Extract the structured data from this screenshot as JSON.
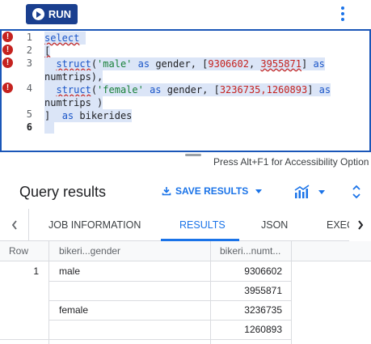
{
  "toolbar": {
    "run_label": "RUN"
  },
  "editor": {
    "lines": [
      {
        "n": "1",
        "error": true
      },
      {
        "n": "2",
        "error": true
      },
      {
        "n": "3",
        "error": true
      },
      {
        "n": "4",
        "error": true
      },
      {
        "n": "5",
        "error": false
      },
      {
        "n": "6",
        "error": false
      }
    ],
    "error_glyph": "!",
    "code": {
      "l1": "select",
      "l2": "[",
      "l3a_struct": "struct",
      "l3a_str": "'male'",
      "l3a_as": "as",
      "l3a_gender": "gender",
      "l3a_n1": "9306602",
      "l3a_n2": "3955871",
      "l3a_as2": "as",
      "l3b": "numtrips),",
      "l4a_struct": "struct",
      "l4a_str": "'female'",
      "l4a_as": "as",
      "l4a_gender": "gender",
      "l4a_nums": "3236735,1260893",
      "l4a_as2": "as",
      "l4b": "numtrips )",
      "l5": "]",
      "l5_as": "as",
      "l5_alias": "bikerides"
    },
    "accessibility_hint": "Press Alt+F1 for Accessibility Option"
  },
  "results": {
    "title": "Query results",
    "save_label": "SAVE RESULTS",
    "tabs": [
      {
        "label": "JOB INFORMATION",
        "active": false
      },
      {
        "label": "RESULTS",
        "active": true
      },
      {
        "label": "JSON",
        "active": false
      },
      {
        "label": "EXEC",
        "active": false
      }
    ],
    "table": {
      "columns": [
        "Row",
        "bikeri...gender",
        "bikeri...numt..."
      ],
      "rows": [
        {
          "row": "1",
          "gender": "male",
          "numtrips": "9306602"
        },
        {
          "row": "",
          "gender": "",
          "numtrips": "3955871"
        },
        {
          "row": "",
          "gender": "female",
          "numtrips": "3236735"
        },
        {
          "row": "",
          "gender": "",
          "numtrips": "1260893"
        }
      ]
    }
  },
  "colors": {
    "run_button": "#1a3f8f",
    "accent": "#1a73e8",
    "error": "#c5221f",
    "selection": "#dbe5f7"
  }
}
